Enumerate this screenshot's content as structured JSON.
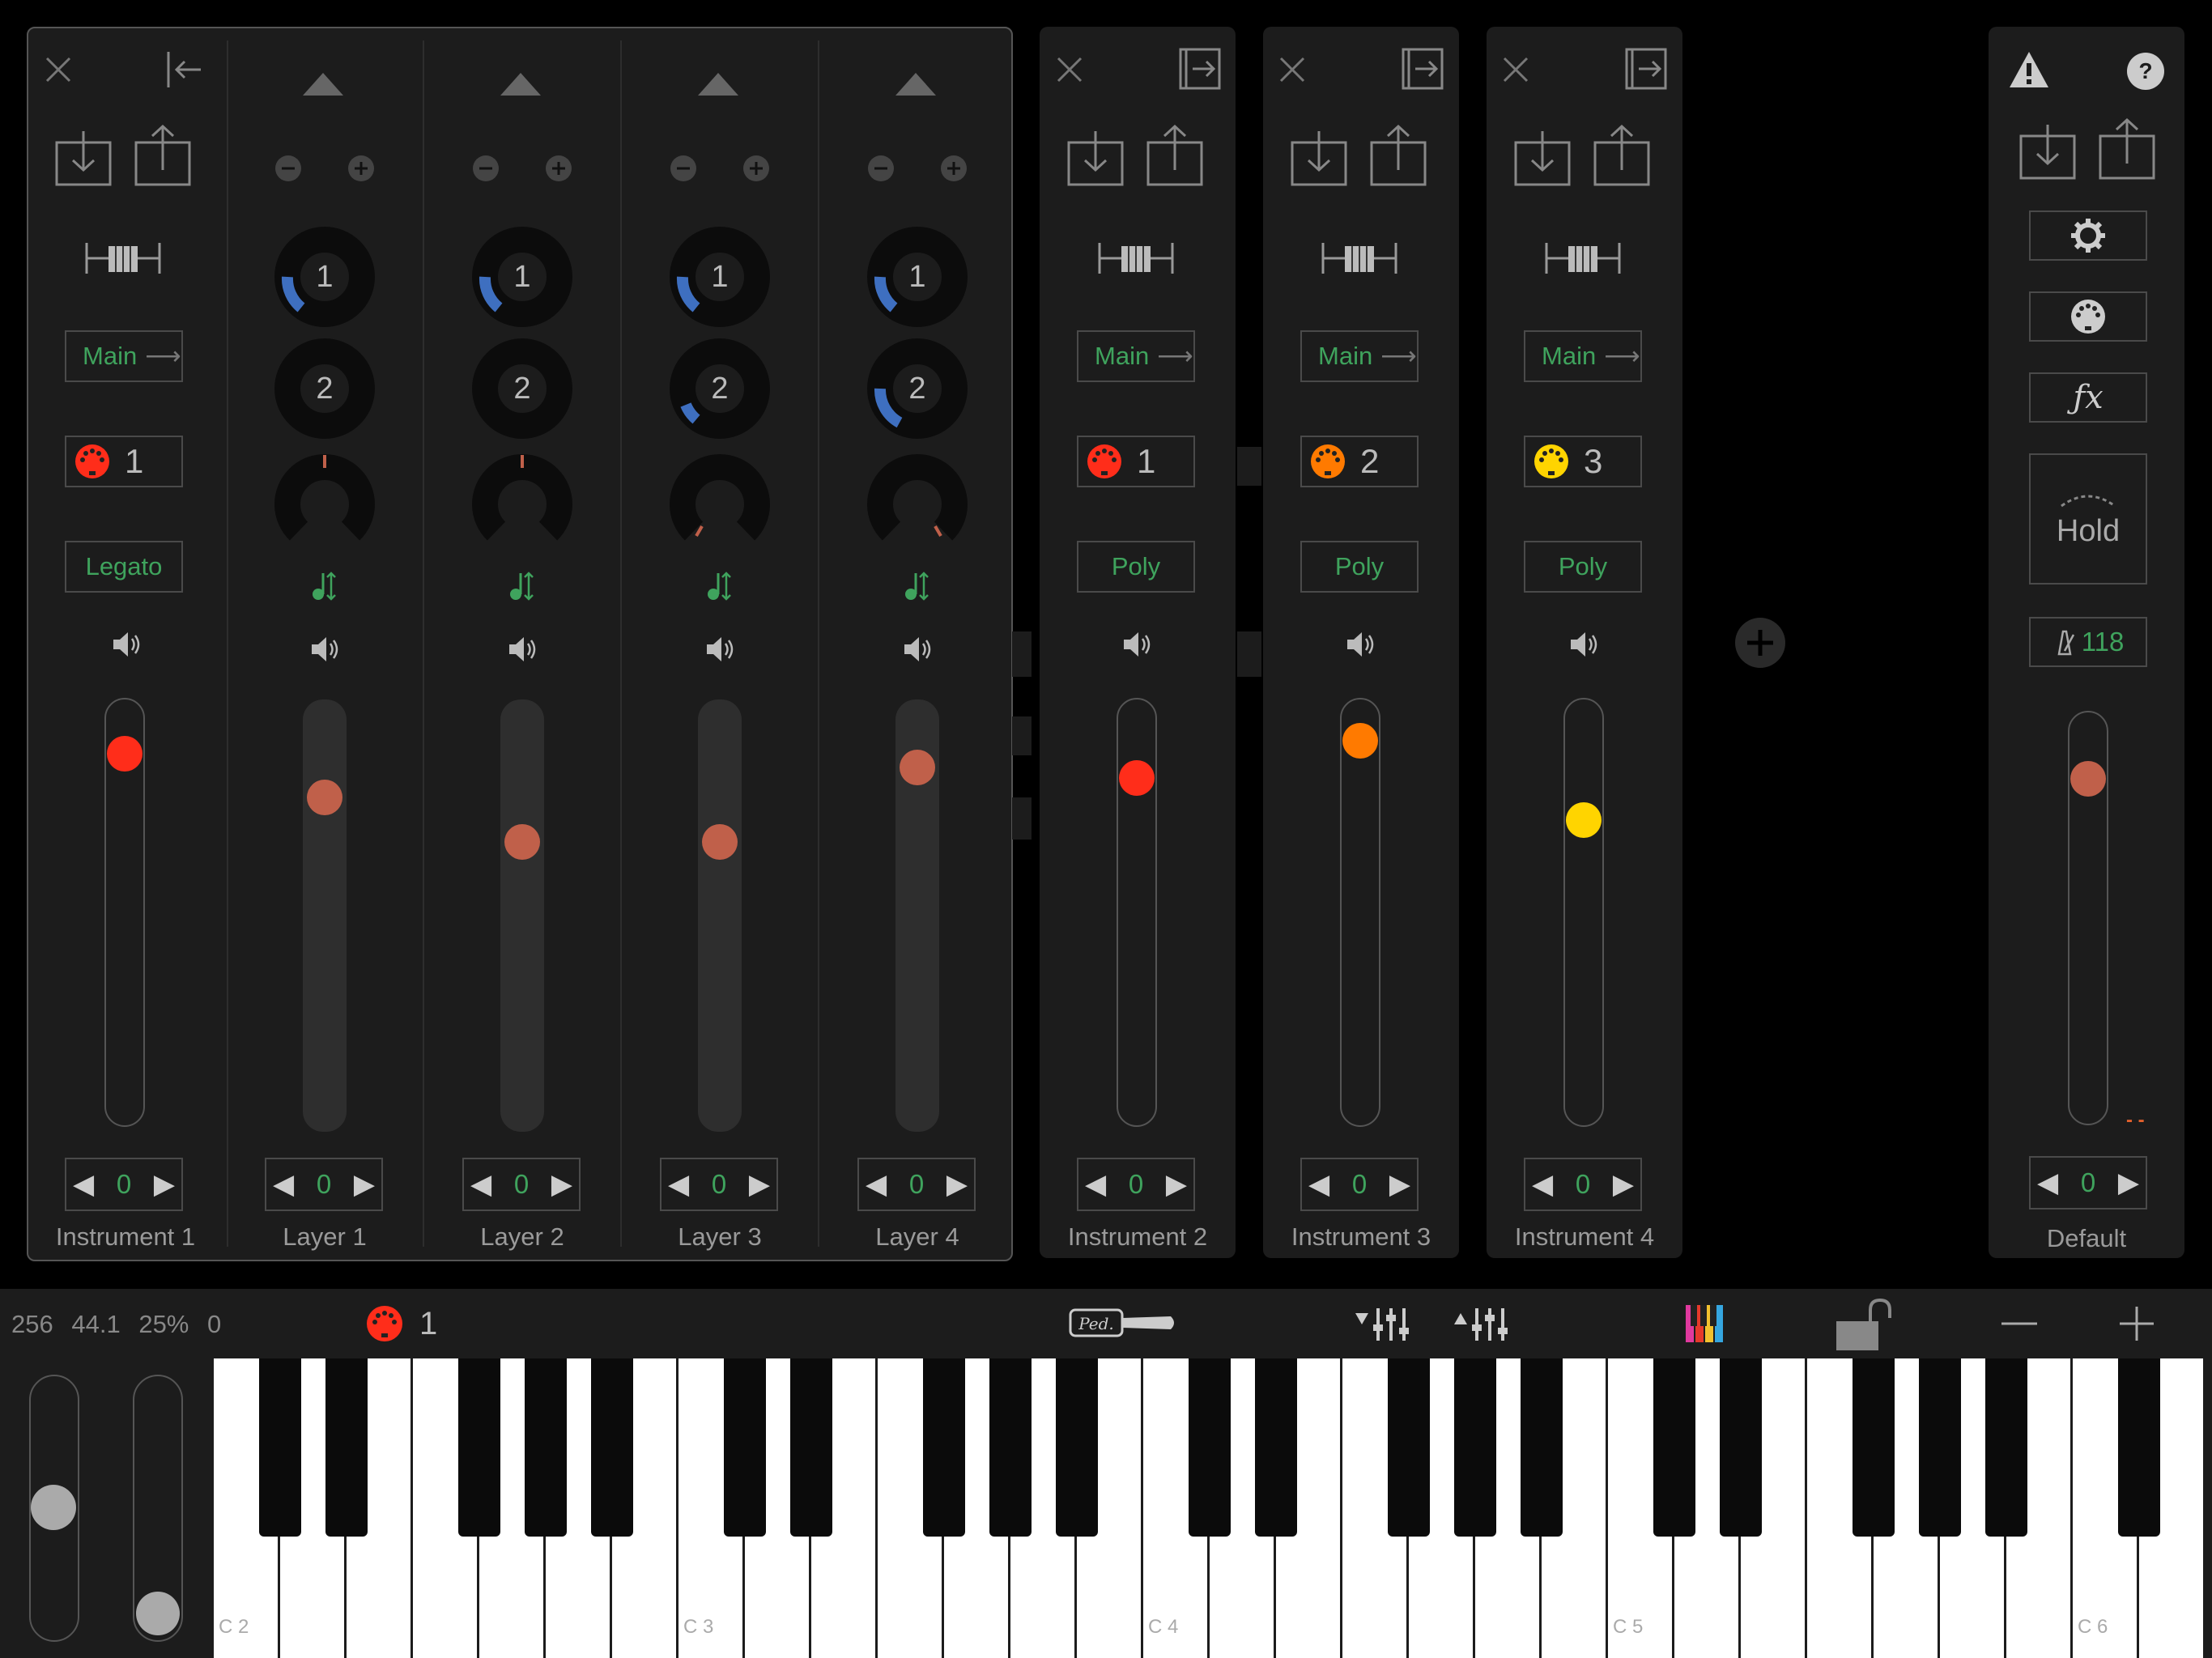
{
  "mixer": {
    "instrument1": {
      "label": "Instrument 1",
      "output": "Main",
      "midi_channel": "1",
      "mode": "Legato",
      "transpose": "0",
      "color": "#ff2d1a"
    },
    "layers": [
      {
        "label": "Layer 1",
        "transpose": "0",
        "knob1": "1",
        "knob2": "2"
      },
      {
        "label": "Layer 2",
        "transpose": "0",
        "knob1": "1",
        "knob2": "2"
      },
      {
        "label": "Layer 3",
        "transpose": "0",
        "knob1": "1",
        "knob2": "2"
      },
      {
        "label": "Layer 4",
        "transpose": "0",
        "knob1": "1",
        "knob2": "2"
      }
    ]
  },
  "instruments": [
    {
      "label": "Instrument 2",
      "output": "Main",
      "midi_channel": "1",
      "mode": "Poly",
      "transpose": "0",
      "color": "#ff2d1a"
    },
    {
      "label": "Instrument 3",
      "output": "Main",
      "midi_channel": "2",
      "mode": "Poly",
      "transpose": "0",
      "color": "#ff7a00"
    },
    {
      "label": "Instrument 4",
      "output": "Main",
      "midi_channel": "3",
      "mode": "Poly",
      "transpose": "0",
      "color": "#ffd400"
    }
  ],
  "master": {
    "label": "Default",
    "hold_label": "Hold",
    "tempo": "118",
    "transpose": "0",
    "fx_label": "ƒx",
    "level_marker": "- -"
  },
  "status": {
    "buffer": "256",
    "rate": "44.1",
    "cpu": "25%",
    "extra": "0",
    "midi_channel": "1"
  },
  "keyboard": {
    "octave_labels": [
      "C 2",
      "C 3",
      "C 4",
      "C 5",
      "C 6"
    ]
  },
  "icons": {
    "close": "close-icon",
    "collapse": "collapse-left-icon",
    "expand": "expand-right-icon",
    "import": "import-icon",
    "export": "export-icon",
    "keyboard_range": "keyboard-range-icon",
    "speaker": "speaker-icon",
    "midi": "midi-din-icon",
    "warning": "warning-icon",
    "help": "help-icon",
    "gear": "gear-icon",
    "palette": "palette-icon",
    "add": "add-icon",
    "lock": "unlock-icon"
  },
  "colors": {
    "accent_green": "#3fa35d",
    "slider_thumb": "#c0604a",
    "knob_blue": "#3e6fc0"
  }
}
